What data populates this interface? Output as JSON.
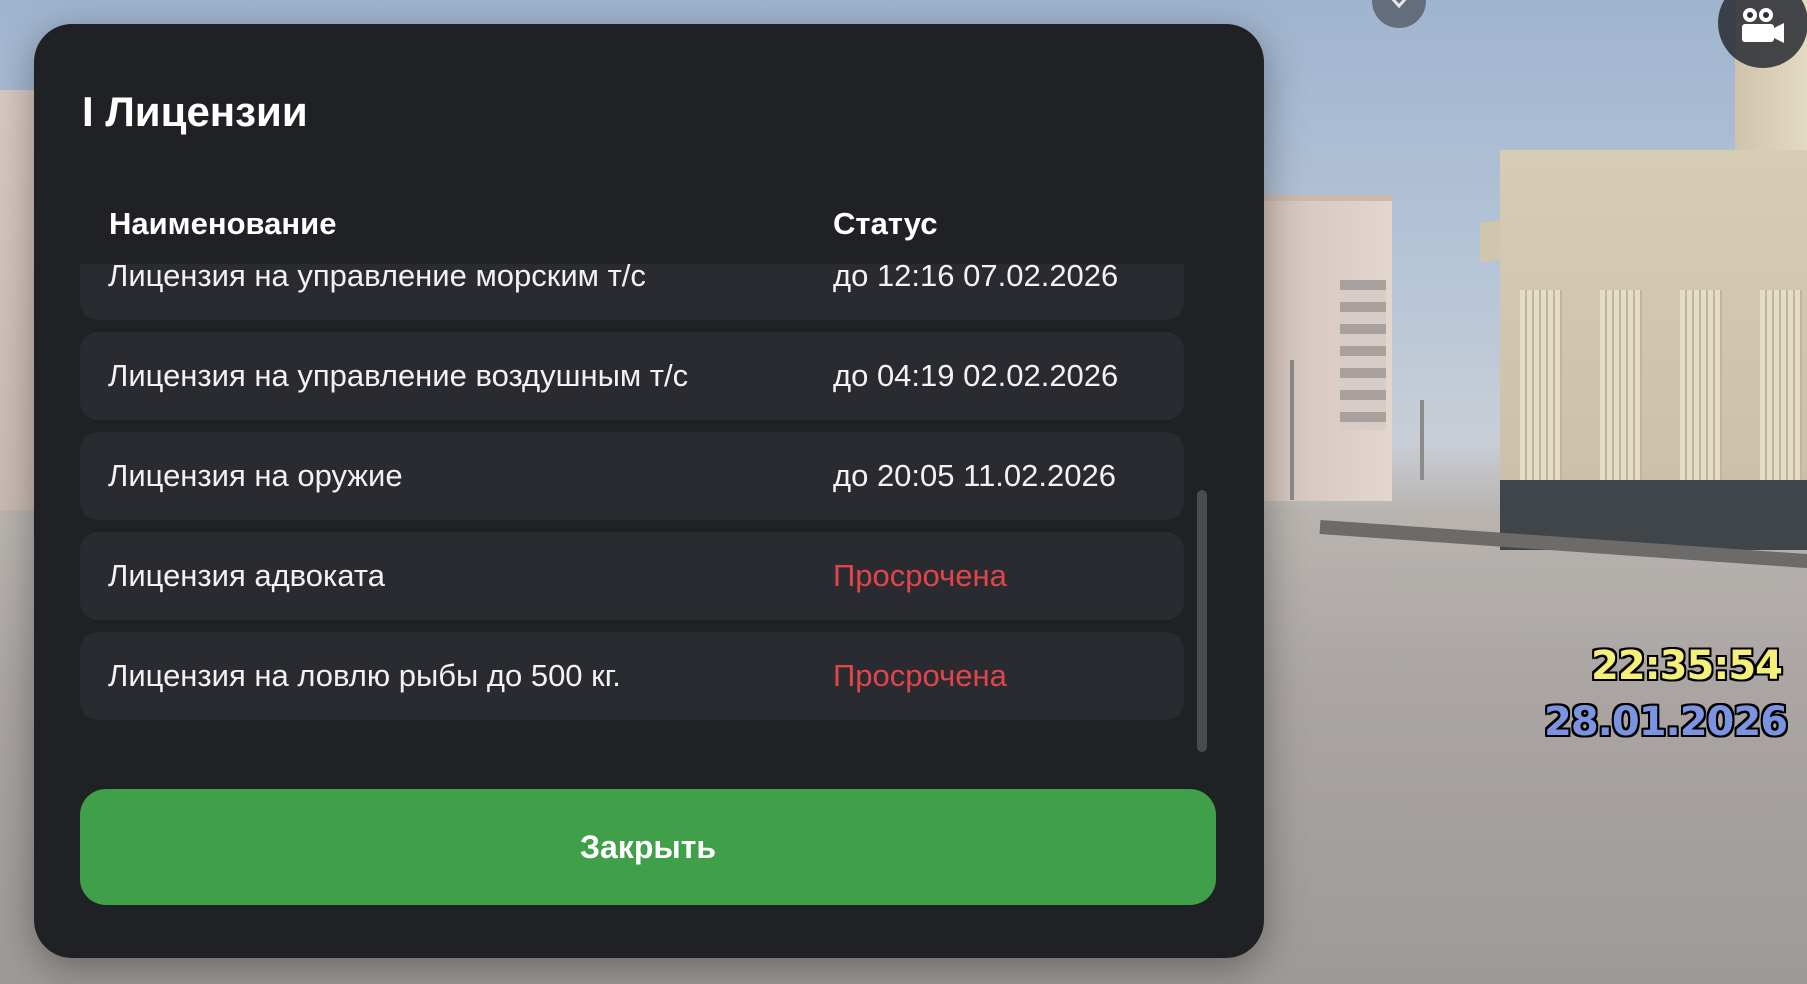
{
  "dialog": {
    "title": "I Лицензии",
    "columns": {
      "name": "Наименование",
      "status": "Статус"
    },
    "rows": [
      {
        "name": "Лицензия на управление морским т/с",
        "status": "до 12:16 07.02.2026",
        "expired": false
      },
      {
        "name": "Лицензия на управление воздушным т/с",
        "status": "до 04:19 02.02.2026",
        "expired": false
      },
      {
        "name": "Лицензия на оружие",
        "status": "до 20:05 11.02.2026",
        "expired": false
      },
      {
        "name": "Лицензия адвоката",
        "status": "Просрочена",
        "expired": true
      },
      {
        "name": "Лицензия на ловлю рыбы до 500 кг.",
        "status": "Просрочена",
        "expired": true
      }
    ],
    "close_label": "Закрыть"
  },
  "hud": {
    "time": "22:35:54",
    "date": "28.01.2026"
  },
  "colors": {
    "panel": "#202125",
    "row": "#2a2b30",
    "accent_green": "#40a04a",
    "expired_red": "#e0454a",
    "hud_time": "#f4f07a",
    "hud_date": "#7b93e0"
  },
  "icons": {
    "camera": "camera-icon",
    "close": "close-icon"
  }
}
